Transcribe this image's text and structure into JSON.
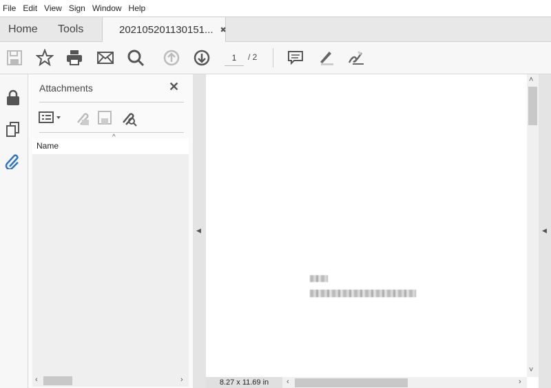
{
  "menu": [
    "File",
    "Edit",
    "View",
    "Sign",
    "Window",
    "Help"
  ],
  "tabs": {
    "home": "Home",
    "tools": "Tools",
    "document": "202105201130151...",
    "close": "✖"
  },
  "toolbar": {
    "page_current": "1",
    "page_total": "/ 2"
  },
  "panel": {
    "title": "Attachments",
    "close": "✕",
    "column_name": "Name",
    "sort": "^"
  },
  "status": {
    "page_size": "8.27 x 11.69 in"
  },
  "scroll": {
    "left": "‹",
    "right": "›",
    "up": "˄",
    "down": "˅",
    "collapse_left": "◀"
  }
}
